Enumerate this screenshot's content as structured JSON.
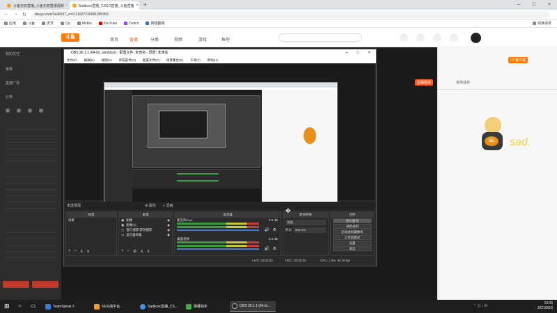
{
  "browser": {
    "tabs": [
      {
        "label": "斗鱼无双直播_斗鱼无双直播视频"
      },
      {
        "label": "Sadkoxx直播_CSGO直播_斗鱼直播"
      }
    ],
    "url": "douyu.com/344815?_rr=0.31697230581095353",
    "bookmarks": [
      {
        "label": "应用"
      },
      {
        "label": "斗鱼"
      },
      {
        "label": "虎牙"
      },
      {
        "label": "Qq"
      },
      {
        "label": "MuMu"
      },
      {
        "label": "YouTube"
      },
      {
        "label": "Twitch"
      },
      {
        "label": "网络翻墙"
      }
    ],
    "bookmarks_right": "阅读清单"
  },
  "douyu": {
    "logo": "斗鱼",
    "nav": [
      "首页",
      "直播",
      "分类",
      "视频",
      "游戏",
      "鱼吧"
    ],
    "sidebar_items": [
      "我的关注",
      "推荐",
      "直播广场",
      "分类"
    ],
    "right_badges": [
      "PC客户端",
      "主播招募",
      "有奖任务"
    ],
    "mascot_text": "sad."
  },
  "obs": {
    "title": "OBS 26.1.1 (64-bit, windows) - 配置文件: 未命名 - 场景: 未命名",
    "menu": [
      "文件(F)",
      "编辑(E)",
      "视图(V)",
      "停靠部件(D)",
      "配置文件(P)",
      "场景集合(S)",
      "工具(T)",
      "帮助(H)"
    ],
    "midbar": {
      "source_label": "未选择源",
      "props": "属性",
      "filters": "滤镜"
    },
    "scenes": {
      "title": "场景",
      "items": [
        "场景"
      ]
    },
    "sources": {
      "title": "来源",
      "items": [
        "图像",
        "图像(2)",
        "窗口捕获/游戏捕获",
        "显示器采集"
      ]
    },
    "mixer": {
      "title": "混音器",
      "channels": [
        {
          "name": "桌面音频",
          "db": "0.0 dB"
        },
        {
          "name": "麦克风/Aux",
          "db": "0.0 dB"
        }
      ]
    },
    "transitions": {
      "title": "转场特效",
      "type": "淡出",
      "duration_label": "时长",
      "duration": "300 ms"
    },
    "controls": {
      "title": "控件",
      "buttons": [
        "停止推流",
        "开始录制",
        "启动虚拟摄像机",
        "工作室模式",
        "设置",
        "退出"
      ]
    },
    "status": {
      "live": "LIVE: 00:00:00",
      "rec": "REC: 00:00:00",
      "cpu": "CPU: 1.0%, 60.00 fps"
    }
  },
  "taskbar": {
    "apps": [
      {
        "label": "TeamSpeak 3",
        "color": "#3b7bd8"
      },
      {
        "label": "5E对战平台",
        "color": "#e8a030"
      },
      {
        "label": "Sadkoxx直播_CS...",
        "color": "#4a90e2"
      },
      {
        "label": "弹幕助手",
        "color": "#44aa44"
      },
      {
        "label": "OBS 26.1.1 (64-bi...",
        "color": "#222222"
      }
    ],
    "time": "19:05",
    "date": "2021/8/16"
  }
}
